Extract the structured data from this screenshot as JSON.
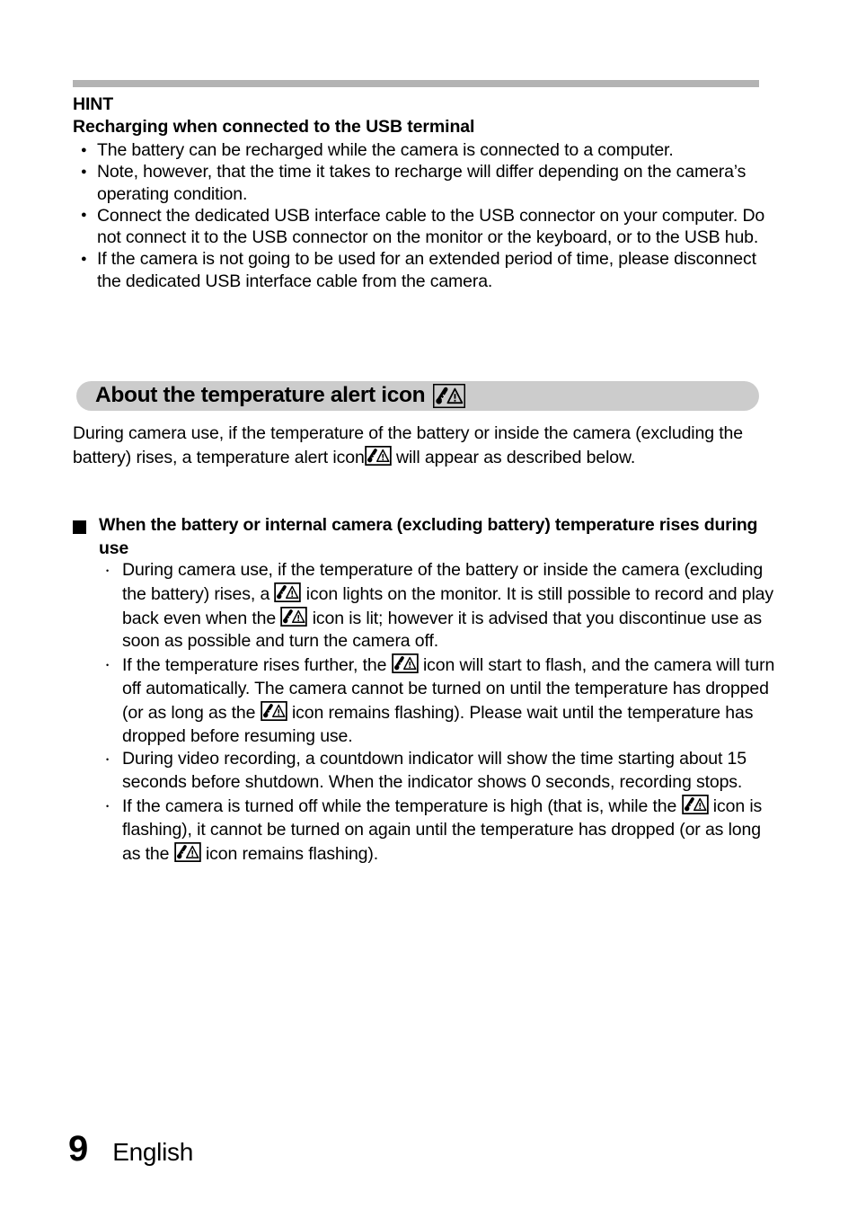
{
  "page": {
    "number": "9",
    "language": "English"
  },
  "hint": {
    "title": "HINT",
    "subtitle": "Recharging when connected to the USB terminal",
    "bullets": [
      "The battery can be recharged while the camera is connected to a computer.",
      "Note, however, that the time it takes to recharge will differ depending on the camera’s operating condition.",
      "Connect the dedicated USB interface cable to the USB connector on your computer. Do not connect it to the USB connector on the monitor or the keyboard, or to the USB hub.",
      "If the camera is not going to be used for an extended period of time, please disconnect the dedicated USB interface cable from the camera."
    ]
  },
  "section": {
    "heading": "About the temperature alert icon",
    "heading_icon": "temperature-alert-icon",
    "intro_part1": "During camera use, if the temperature of the battery or inside the camera (excluding the battery) rises, a temperature alert icon",
    "intro_part2": "will appear as described below."
  },
  "subsection": {
    "heading": "When the battery or internal camera (excluding battery) temperature rises during use",
    "items": [
      {
        "segments": [
          "During camera use, if the temperature of the battery or inside the camera (excluding the battery) rises, a",
          "icon lights on the monitor. It is still possible to record and play back even when the",
          "icon is lit; however it is advised that you discontinue use as soon as possible and turn the camera off."
        ]
      },
      {
        "segments": [
          "If the temperature rises further, the",
          "icon will start to flash, and the camera will turn off automatically.",
          "The camera cannot be turned on until the temperature has dropped (or as long as the",
          "icon remains flashing). Please wait until the temperature has dropped before resuming use."
        ]
      },
      {
        "segments": [
          "During video recording, a countdown indicator will show the time starting about 15 seconds before shutdown. When the indicator shows 0 seconds, recording stops."
        ]
      },
      {
        "segments": [
          "If the camera is turned off while the temperature is high (that is, while the",
          "icon is flashing), it cannot be turned on again until the temperature has dropped (or as long as the",
          "icon remains flashing)."
        ]
      }
    ]
  },
  "colors": {
    "rule_gray": "#b3b3b3",
    "band_gray": "#cccccc",
    "text": "#000000",
    "page_background": "#ffffff"
  }
}
